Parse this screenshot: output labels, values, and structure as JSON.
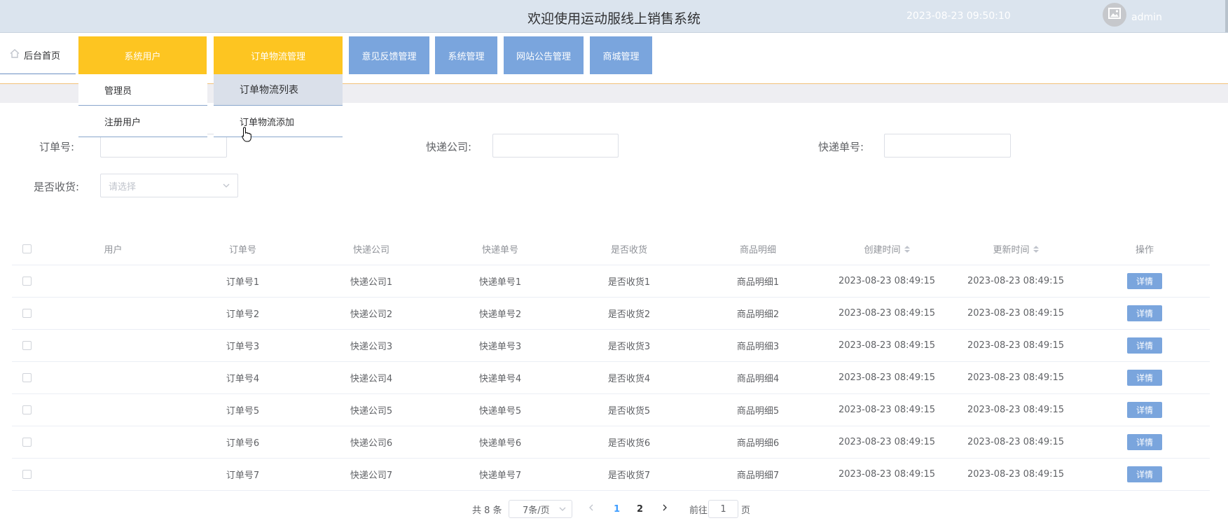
{
  "header": {
    "title": "欢迎使用运动服线上销售系统",
    "datetime": "2023-08-23 09:50:10",
    "username": "admin",
    "avatar_icon": "image-icon"
  },
  "nav": {
    "home_label": "后台首页",
    "home_icon": "home-icon",
    "items": [
      {
        "label": "系统用户",
        "color": "#fdc521"
      },
      {
        "label": "订单物流管理",
        "color": "#fdc521"
      },
      {
        "label": "意见反馈管理",
        "color": "#7aa5dd"
      },
      {
        "label": "系统管理",
        "color": "#7aa5dd"
      },
      {
        "label": "网站公告管理",
        "color": "#7aa5dd"
      },
      {
        "label": "商城管理",
        "color": "#7aa5dd"
      }
    ],
    "dropdown_users": [
      "管理员",
      "注册用户"
    ],
    "dropdown_orders": [
      "订单物流列表",
      "订单物流添加"
    ]
  },
  "search": {
    "order_no_label": "订单号:",
    "courier_label": "快递公司:",
    "tracking_label": "快递单号:",
    "received_label": "是否收货:",
    "received_placeholder": "请选择"
  },
  "table": {
    "columns": [
      "用户",
      "订单号",
      "快递公司",
      "快递单号",
      "是否收货",
      "商品明细",
      "创建时间",
      "更新时间",
      "操作"
    ],
    "action_label": "详情",
    "rows": [
      {
        "user": "",
        "order": "订单号1",
        "courier": "快递公司1",
        "tracking": "快递单号1",
        "received": "是否收货1",
        "detail": "商品明细1",
        "created": "2023-08-23 08:49:15",
        "updated": "2023-08-23 08:49:15"
      },
      {
        "user": "",
        "order": "订单号2",
        "courier": "快递公司2",
        "tracking": "快递单号2",
        "received": "是否收货2",
        "detail": "商品明细2",
        "created": "2023-08-23 08:49:15",
        "updated": "2023-08-23 08:49:15"
      },
      {
        "user": "",
        "order": "订单号3",
        "courier": "快递公司3",
        "tracking": "快递单号3",
        "received": "是否收货3",
        "detail": "商品明细3",
        "created": "2023-08-23 08:49:15",
        "updated": "2023-08-23 08:49:15"
      },
      {
        "user": "",
        "order": "订单号4",
        "courier": "快递公司4",
        "tracking": "快递单号4",
        "received": "是否收货4",
        "detail": "商品明细4",
        "created": "2023-08-23 08:49:15",
        "updated": "2023-08-23 08:49:15"
      },
      {
        "user": "",
        "order": "订单号5",
        "courier": "快递公司5",
        "tracking": "快递单号5",
        "received": "是否收货5",
        "detail": "商品明细5",
        "created": "2023-08-23 08:49:15",
        "updated": "2023-08-23 08:49:15"
      },
      {
        "user": "",
        "order": "订单号6",
        "courier": "快递公司6",
        "tracking": "快递单号6",
        "received": "是否收货6",
        "detail": "商品明细6",
        "created": "2023-08-23 08:49:15",
        "updated": "2023-08-23 08:49:15"
      },
      {
        "user": "",
        "order": "订单号7",
        "courier": "快递公司7",
        "tracking": "快递单号7",
        "received": "是否收货7",
        "detail": "商品明细7",
        "created": "2023-08-23 08:49:15",
        "updated": "2023-08-23 08:49:15"
      }
    ]
  },
  "pagination": {
    "total": "共 8 条",
    "page_size": "7条/页",
    "pages": [
      "1",
      "2"
    ],
    "current_page": "1",
    "goto_label": "前往",
    "goto_value": "1",
    "page_suffix": "页",
    "active_color": "#409eff"
  }
}
